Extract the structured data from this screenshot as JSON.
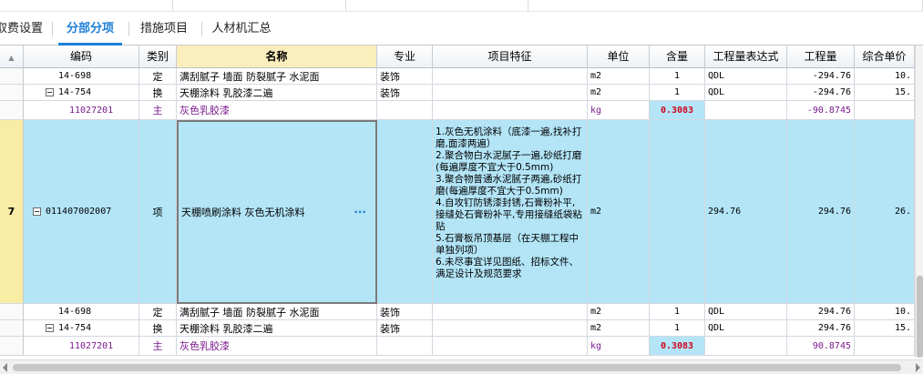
{
  "tabs": [
    {
      "label": "取费设置"
    },
    {
      "label": "分部分项"
    },
    {
      "label": "措施项目"
    },
    {
      "label": "人材机汇总"
    }
  ],
  "active_tab_index": 1,
  "columns": {
    "code": "编码",
    "category": "类别",
    "name": "名称",
    "specialty": "专业",
    "features": "项目特征",
    "unit": "单位",
    "content": "含量",
    "expression": "工程量表达式",
    "quantity": "工程量",
    "unit_price": "综合单价"
  },
  "rows": [
    {
      "code": "14-698",
      "category": "定",
      "name": "满刮腻子 墙面 防裂腻子 水泥面",
      "specialty": "装饰",
      "unit": "m2",
      "content": "1",
      "expression": "QDL",
      "quantity": "-294.76",
      "unit_price": "10."
    },
    {
      "code": "14-754",
      "category": "换",
      "name": "天棚涂料 乳胶漆二遍",
      "specialty": "装饰",
      "unit": "m2",
      "content": "1",
      "expression": "QDL",
      "quantity": "-294.76",
      "unit_price": "15."
    },
    {
      "code": "11027201",
      "category": "主",
      "name": "灰色乳胶漆",
      "specialty": "",
      "unit": "kg",
      "content": "0.3083",
      "expression": "",
      "quantity": "-90.8745",
      "unit_price": ""
    },
    {
      "row_number": "7",
      "code": "011407002007",
      "category": "项",
      "name": "天棚喷刷涂料 灰色无机涂料",
      "specialty": "",
      "features": "1.灰色无机涂料（底漆一遍,找补打磨,面漆两遍）\n2.聚合物白水泥腻子一遍,砂纸打磨(每遍厚度不宜大于0.5mm)\n3.聚合物普通水泥腻子两遍,砂纸打磨(每遍厚度不宜大于0.5mm)\n4.自攻钉防锈漆封锈,石膏粉补平,接缝处石膏粉补平,专用接缝纸袋粘贴\n5.石膏板吊顶基层（在天棚工程中单独列项）\n6.未尽事宜详见图纸、招标文件、满足设计及规范要求",
      "unit": "m2",
      "content": "",
      "expression": "294.76",
      "quantity": "294.76",
      "unit_price": "26.",
      "edit_button": "···"
    },
    {
      "code": "14-698",
      "category": "定",
      "name": "满刮腻子 墙面 防裂腻子 水泥面",
      "specialty": "装饰",
      "unit": "m2",
      "content": "1",
      "expression": "QDL",
      "quantity": "294.76",
      "unit_price": "10."
    },
    {
      "code": "14-754",
      "category": "换",
      "name": "天棚涂料 乳胶漆二遍",
      "specialty": "装饰",
      "unit": "m2",
      "content": "1",
      "expression": "QDL",
      "quantity": "294.76",
      "unit_price": "15."
    },
    {
      "code": "11027201",
      "category": "主",
      "name": "灰色乳胶漆",
      "specialty": "",
      "unit": "kg",
      "content": "0.3083",
      "expression": "",
      "quantity": "90.8745",
      "unit_price": ""
    }
  ],
  "colors": {
    "accent": "#1e80d6",
    "selected_row": "#b3e5f7",
    "material_text": "#7a1a8c",
    "highlight_value": "#d0021b",
    "header_highlight": "#fbeebd"
  }
}
